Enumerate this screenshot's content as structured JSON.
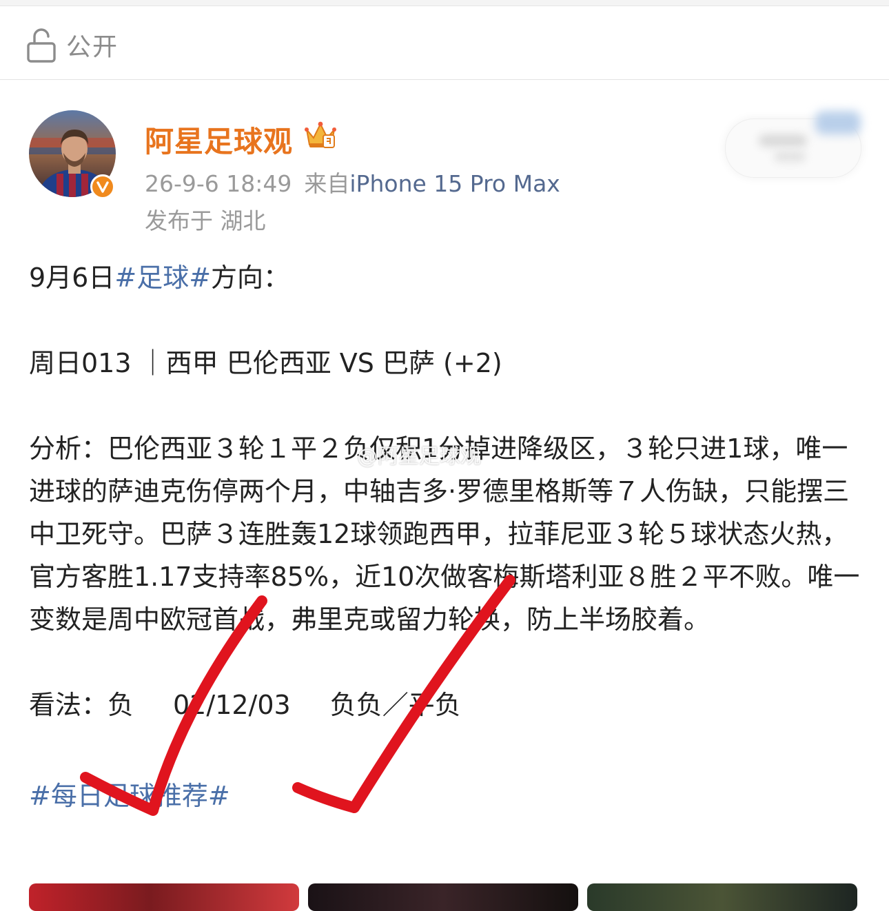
{
  "privacy": {
    "label": "公开",
    "icon": "lock-open-icon"
  },
  "author": {
    "name": "阿星足球观",
    "badge_icon": "crown-vip-icon",
    "verified_icon": "verified-v-icon",
    "verified_color": "#f08a1e",
    "name_color": "#e8741e"
  },
  "post_meta": {
    "timestamp": "26-9-6 18:49",
    "source_prefix": "来自",
    "source_device": "iPhone 15 Pro Max",
    "location": "发布于 湖北"
  },
  "post": {
    "intro_prefix": "9月6日",
    "intro_tag": "#足球#",
    "intro_suffix": "方向：",
    "match_line": "周日013 ｜西甲 巴伦西亚 VS 巴萨 (+2)",
    "analysis": "分析：巴伦西亚３轮１平２负仅积1分掉进降级区，３轮只进1球，唯一进球的萨迪克伤停两个月，中轴吉多·罗德里格斯等７人伤缺，只能摆三中卫死守。巴萨３连胜轰12球领跑西甲，拉菲尼亚３轮５球状态火热，官方客胜1.17支持率85%，近10次做客梅斯塔利亚８胜２平不败。唯一变数是周中欧冠首战，弗里克或留力轮换，防上半场胶着。",
    "view_label": "看法：",
    "view_pick": "负",
    "view_scores": "02/12/03",
    "view_halffull": "负负／平负",
    "footer_tag": "#每日足球推荐#",
    "watermark": "@阿星足球观",
    "hashtag_color": "#4a6fa8"
  },
  "annotation": {
    "mark": "check-mark-icon",
    "color": "#e0141e",
    "count": 2
  }
}
